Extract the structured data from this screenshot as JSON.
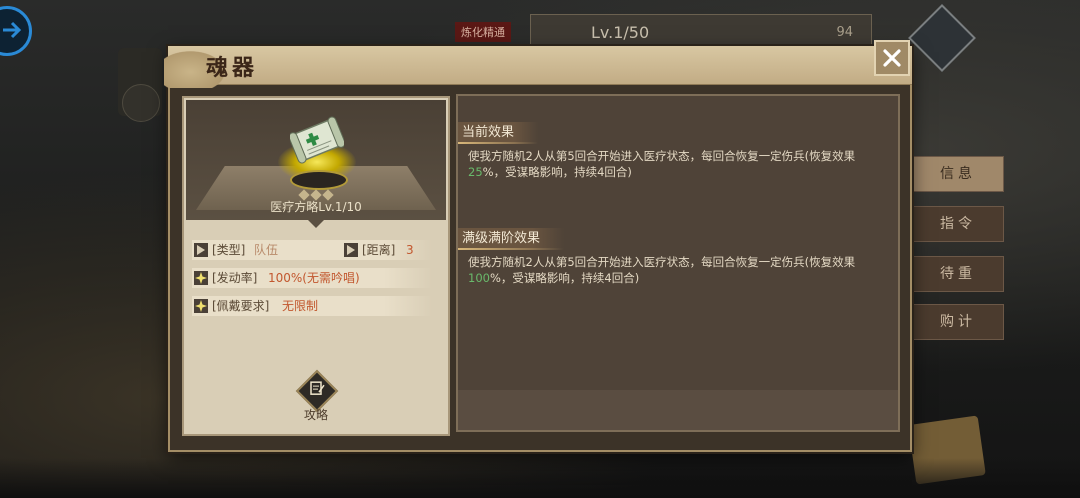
{
  "background": {
    "tab_label": "炼化精通",
    "level_text": "Lv.1/50",
    "level_num": "94",
    "right_menu": [
      "信息",
      "指令",
      "待重",
      "购计"
    ]
  },
  "dialog": {
    "title": "魂器",
    "item": {
      "name": "医疗方略Lv.1/10",
      "icon": "medical-scroll-icon"
    },
    "attributes": {
      "type_label": "[类型]",
      "type_value": "队伍",
      "range_label": "[距离]",
      "range_value": "3",
      "rate_label": "[发动率]",
      "rate_value": "100%(无需吟唱)",
      "equip_label": "[佩戴要求]",
      "equip_value": "无限制"
    },
    "strategy_label": "攻略",
    "current_effect": {
      "header": "当前效果",
      "text_before": "使我方随机2人从第5回合开始进入医疗状态，每回合恢复一定伤兵(恢复效果",
      "percent": "25",
      "text_after": "%，受谋略影响，持续4回合)"
    },
    "max_effect": {
      "header": "满级满阶效果",
      "text_before": "使我方随机2人从第5回合开始进入医疗状态，每回合恢复一定伤兵(恢复效果",
      "percent": "100",
      "text_after": "%，受谋略影响，持续4回合)"
    }
  },
  "colors": {
    "accent_value": "#c2572e",
    "percent_green": "#69b96b",
    "frame_gold": "#a48e66"
  }
}
